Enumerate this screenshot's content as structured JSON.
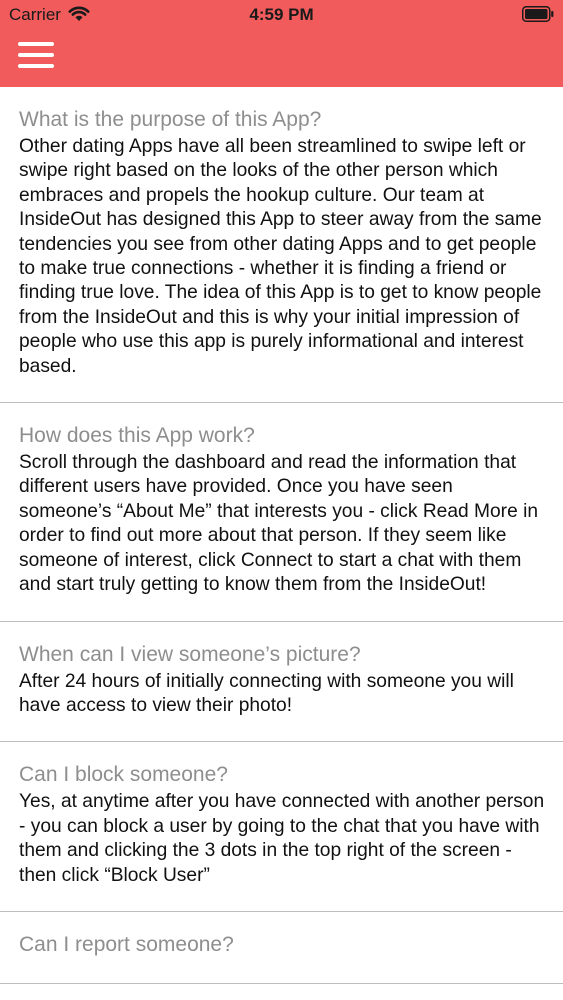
{
  "status_bar": {
    "carrier": "Carrier",
    "time": "4:59 PM"
  },
  "header": {
    "background_color": "#f15b5b",
    "menu_icon": "hamburger-menu-icon"
  },
  "faq": [
    {
      "question": "What is the purpose of this App?",
      "answer": "Other dating Apps have all been streamlined to swipe left or swipe right based on the looks of the other person which embraces and propels the hookup culture. Our team at InsideOut has designed this App to steer away from the same tendencies you see from other dating Apps and to get people to make true connections - whether it is finding a friend or finding true love. The idea of this App is to get to know people from the InsideOut and this is why your initial impression of people who use this app is purely informational and interest based."
    },
    {
      "question": "How does this App work?",
      "answer": "Scroll through the dashboard and read the information that different users have provided. Once you have seen someone’s “About Me” that interests you - click Read More in order to find out more about that person. If they seem like someone of interest, click Connect to start a chat with them and start truly getting to know them from the InsideOut!"
    },
    {
      "question": "When can I view someone’s picture?",
      "answer": "After 24 hours of initially connecting with someone you will have access to view their photo!"
    },
    {
      "question": "Can I block someone?",
      "answer": "Yes, at anytime after you have connected with another person - you can block a user by going to the chat that you have with them and clicking the 3 dots in the top right of the screen - then click “Block User”"
    },
    {
      "question": "Can I report someone?",
      "answer": ""
    }
  ]
}
